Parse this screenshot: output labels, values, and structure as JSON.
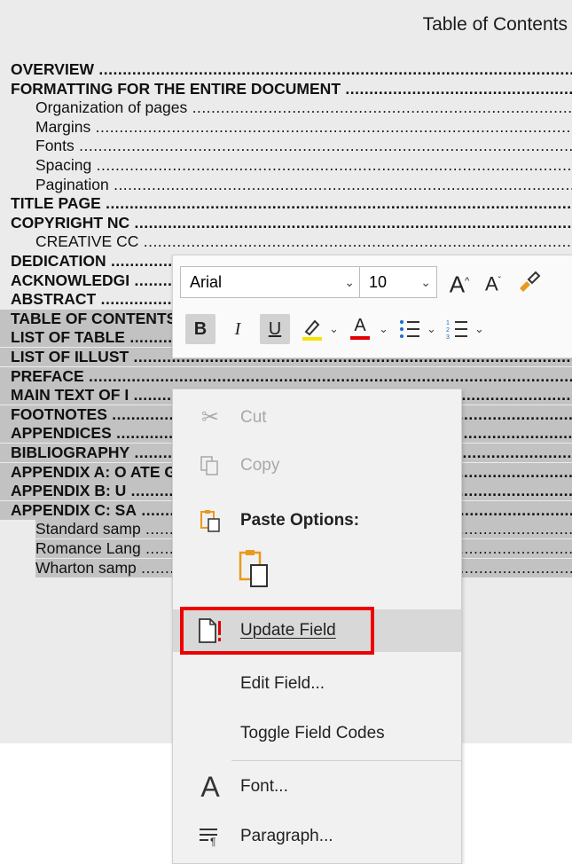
{
  "document": {
    "toc_title": "Table of Contents",
    "entries": [
      {
        "text": "OVERVIEW",
        "level": 1,
        "selected": false
      },
      {
        "text": "FORMATTING FOR THE ENTIRE DOCUMENT",
        "level": 1,
        "selected": false
      },
      {
        "text": "Organization of pages",
        "level": 2,
        "selected": false
      },
      {
        "text": "Margins",
        "level": 2,
        "selected": false
      },
      {
        "text": "Fonts",
        "level": 2,
        "selected": false
      },
      {
        "text": "Spacing",
        "level": 2,
        "selected": false
      },
      {
        "text": "Pagination",
        "level": 2,
        "selected": false
      },
      {
        "text": "TITLE PAGE",
        "level": 1,
        "selected": false
      },
      {
        "text": "COPYRIGHT NC",
        "level": 1,
        "selected": false
      },
      {
        "text": "CREATIVE CC",
        "level": 2,
        "selected": false
      },
      {
        "text": "DEDICATION",
        "level": 1,
        "selected": false
      },
      {
        "text": "ACKNOWLEDGI",
        "level": 1,
        "selected": false
      },
      {
        "text": "ABSTRACT",
        "level": 1,
        "selected": false
      },
      {
        "text": "TABLE OF CONTENTS",
        "level": 1,
        "selected": true
      },
      {
        "text": "LIST OF TABLE",
        "level": 1,
        "selected": true
      },
      {
        "text": "LIST OF ILLUST",
        "level": 1,
        "selected": true
      },
      {
        "text": "PREFACE",
        "level": 1,
        "selected": true
      },
      {
        "text": "MAIN TEXT OF I",
        "level": 1,
        "selected": true
      },
      {
        "text": "FOOTNOTES",
        "level": 1,
        "selected": true
      },
      {
        "text": "APPENDICES",
        "level": 1,
        "selected": true
      },
      {
        "text": "BIBLIOGRAPHY",
        "level": 1,
        "selected": true
      },
      {
        "text": "APPENDIX A: O                                          ATE GROUP",
        "level": 1,
        "selected": true
      },
      {
        "text": "APPENDIX B: U",
        "level": 1,
        "selected": true
      },
      {
        "text": "APPENDIX C: SA",
        "level": 1,
        "selected": true
      },
      {
        "text": "Standard samp",
        "level": 2,
        "selected": true
      },
      {
        "text": "Romance Lang",
        "level": 2,
        "selected": true
      },
      {
        "text": "Wharton samp",
        "level": 2,
        "selected": true
      }
    ]
  },
  "mini_toolbar": {
    "font_name": "Arial",
    "font_size": "10",
    "grow_font": "A",
    "shrink_font": "A",
    "bold": "B",
    "italic": "I",
    "underline": "U",
    "font_color": "A",
    "highlight_color": "#f4e300",
    "font_color_value": "#e00000"
  },
  "context_menu": {
    "items": [
      {
        "label": "Cut",
        "icon": "scissors-icon",
        "disabled": true
      },
      {
        "label": "Copy",
        "icon": "copy-icon",
        "disabled": true
      },
      {
        "label": "Paste Options:",
        "icon": "paste-icon",
        "disabled": false
      },
      {
        "label": "Update Field",
        "icon": "update-field-icon",
        "disabled": false,
        "highlighted": true
      },
      {
        "label": "Edit Field...",
        "icon": "",
        "disabled": false
      },
      {
        "label": "Toggle Field Codes",
        "icon": "",
        "disabled": false
      },
      {
        "label": "Font...",
        "icon": "font-icon",
        "disabled": false
      },
      {
        "label": "Paragraph...",
        "icon": "paragraph-icon",
        "disabled": false
      }
    ]
  }
}
